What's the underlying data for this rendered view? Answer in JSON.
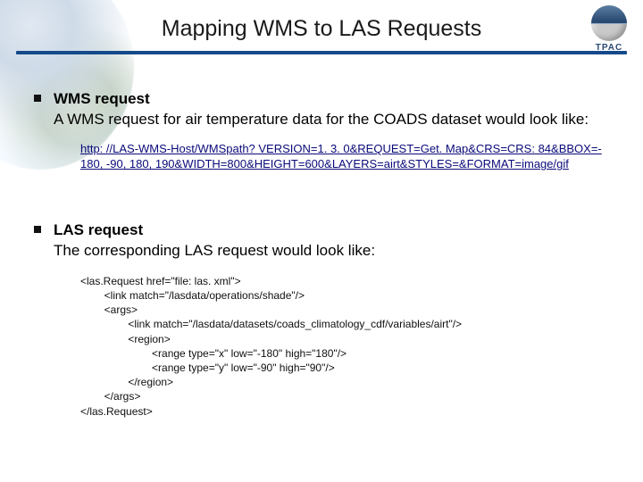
{
  "title": "Mapping WMS to LAS Requests",
  "logo": {
    "label": "TPAC"
  },
  "section1": {
    "heading_strong": "WMS request",
    "heading_rest": "A WMS request for air temperature data for the COADS dataset would look like:",
    "link_line1": "http: //LAS-WMS-Host/WMSpath? VERSION=1. 3. 0&REQUEST=Get. Map&CRS=CRS: 84&BBOX=-",
    "link_line2": "180, -90, 180, 190&WIDTH=800&HEIGHT=600&LAYERS=airt&STYLES=&FORMAT=image/gif"
  },
  "section2": {
    "heading_strong": "LAS request",
    "heading_rest": "The corresponding LAS request would look like:",
    "code": "<las.Request href=\"file: las. xml\">\n        <link match=\"/lasdata/operations/shade\"/>\n        <args>\n                <link match=\"/lasdata/datasets/coads_climatology_cdf/variables/airt\"/>\n                <region>\n                        <range type=\"x\" low=\"-180\" high=\"180\"/>\n                        <range type=\"y\" low=\"-90\" high=\"90\"/>\n                </region>\n        </args>\n</las.Request>"
  }
}
